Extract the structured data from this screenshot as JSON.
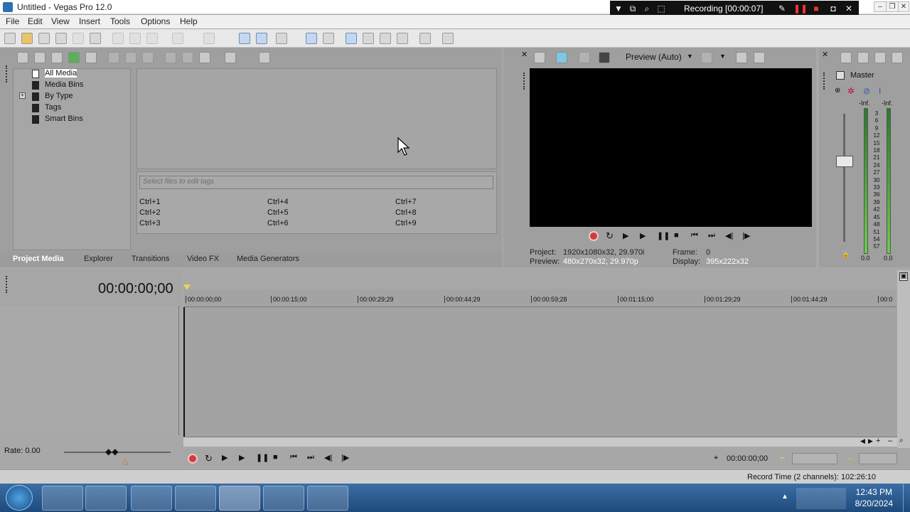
{
  "window": {
    "title": "Untitled - Vegas Pro 12.0"
  },
  "recorder": {
    "status": "Recording [00:00:07]"
  },
  "menu": [
    "File",
    "Edit",
    "View",
    "Insert",
    "Tools",
    "Options",
    "Help"
  ],
  "media_tree": {
    "items": [
      {
        "label": "All Media",
        "selected": true
      },
      {
        "label": "Media Bins"
      },
      {
        "label": "By Type",
        "expandable": true
      },
      {
        "label": "Tags"
      },
      {
        "label": "Smart Bins"
      }
    ]
  },
  "tags": {
    "placeholder": "Select files to edit tags",
    "shortcuts": [
      "Ctrl+1",
      "Ctrl+2",
      "Ctrl+3",
      "Ctrl+4",
      "Ctrl+5",
      "Ctrl+6",
      "Ctrl+7",
      "Ctrl+8",
      "Ctrl+9"
    ]
  },
  "tabs": [
    "Project Media",
    "Explorer",
    "Transitions",
    "Video FX",
    "Media Generators"
  ],
  "preview": {
    "mode": "Preview (Auto)",
    "project_label": "Project:",
    "project_value": "1920x1080x32, 29.970i",
    "preview_label": "Preview:",
    "preview_value": "480x270x32, 29.970p",
    "frame_label": "Frame:",
    "frame_value": "0",
    "display_label": "Display:",
    "display_value": "395x222x32"
  },
  "mixer": {
    "title": "Master",
    "left_peak": "-Inf.",
    "right_peak": "-Inf.",
    "scale": [
      "3",
      "6",
      "9",
      "12",
      "15",
      "18",
      "21",
      "24",
      "27",
      "30",
      "33",
      "36",
      "39",
      "42",
      "45",
      "48",
      "51",
      "54",
      "57"
    ],
    "left_value": "0.0",
    "right_value": "0.0"
  },
  "timeline": {
    "timecode": "00:00:00;00",
    "ruler": [
      "00:00:00;00",
      "00:00:15;00",
      "00:00:29;29",
      "00:00:44;29",
      "00:00:59;28",
      "00:01:15;00",
      "00:01:29;29",
      "00:01:44;29",
      "00:0"
    ],
    "rate": "Rate: 0.00",
    "cursor_time": "00:00:00;00"
  },
  "status": {
    "record_time": "Record Time (2 channels): 102:26:10"
  },
  "taskbar": {
    "time": "12:43 PM",
    "date": "8/20/2024"
  },
  "colors": {
    "accent": "#2f6fb3",
    "record": "#d23b3b"
  }
}
